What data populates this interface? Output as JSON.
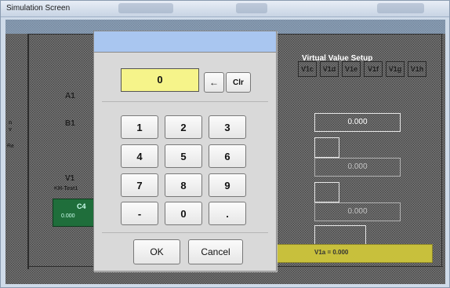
{
  "window": {
    "title": "Simulation Screen"
  },
  "background": {
    "virtual_header": "Virtual Value Setup",
    "tabs": [
      "V1c",
      "V1d",
      "V1e",
      "V1f",
      "V1g",
      "V1h"
    ],
    "channel_labels": [
      "A1",
      "B1",
      "V1"
    ],
    "channel_sublabel": "KH-Test1",
    "green_box": {
      "label": "C4",
      "value": "0.000"
    },
    "left_markers": [
      "n",
      "v",
      "Re"
    ],
    "right_values": [
      "0.000",
      "0.000",
      "0.000"
    ],
    "footer_value": "V1a = 0.000"
  },
  "keypad": {
    "display_value": "0",
    "backspace_symbol": "←",
    "clear_label": "Clr",
    "keys": [
      "1",
      "2",
      "3",
      "4",
      "5",
      "6",
      "7",
      "8",
      "9",
      "-",
      "0",
      "."
    ],
    "ok_label": "OK",
    "cancel_label": "Cancel"
  }
}
